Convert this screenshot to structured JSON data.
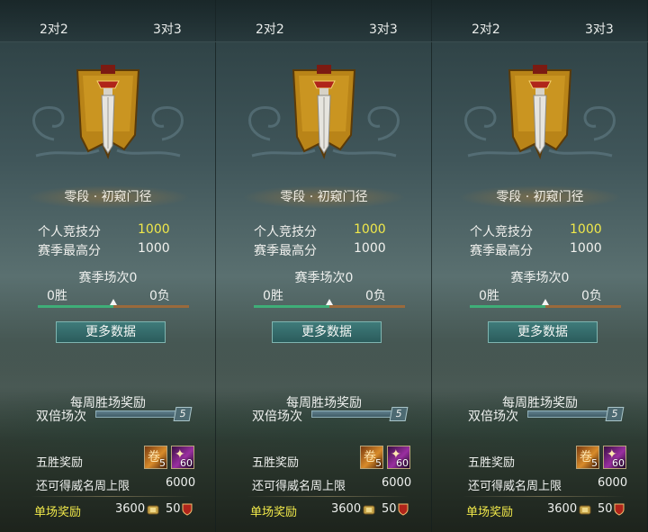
{
  "colors": {
    "score_yellow": "#f0e84a",
    "progress_win": "#3fae78",
    "progress_loss": "#9a6a3c",
    "button": "#2f6a68"
  },
  "panels": [
    {
      "tabs": [
        "2对2",
        "3对3"
      ],
      "rank_title": "零段 · 初窥门径",
      "personal_score_label": "个人竞技分",
      "personal_score": "1000",
      "season_high_label": "赛季最高分",
      "season_high": "1000",
      "season_matches": "赛季场次0",
      "wins": "0胜",
      "losses": "0负",
      "progress_fraction": 0.5,
      "more_data": "更多数据",
      "weekly_title": "每周胜场奖励",
      "double_label": "双倍场次",
      "double_count": "5",
      "five_win_label": "五胜奖励",
      "reward_items": [
        {
          "icon": "scroll-icon",
          "count": "5"
        },
        {
          "icon": "potion-icon",
          "count": "60"
        }
      ],
      "cap_label": "还可得威名周上限",
      "cap_value": "6000",
      "single_label": "单场奖励",
      "single_value1": "3600",
      "single_value2": "50"
    },
    {
      "tabs": [
        "2对2",
        "3对3"
      ],
      "rank_title": "零段 · 初窥门径",
      "personal_score_label": "个人竞技分",
      "personal_score": "1000",
      "season_high_label": "赛季最高分",
      "season_high": "1000",
      "season_matches": "赛季场次0",
      "wins": "0胜",
      "losses": "0负",
      "progress_fraction": 0.5,
      "more_data": "更多数据",
      "weekly_title": "每周胜场奖励",
      "double_label": "双倍场次",
      "double_count": "5",
      "five_win_label": "五胜奖励",
      "reward_items": [
        {
          "icon": "scroll-icon",
          "count": "5"
        },
        {
          "icon": "potion-icon",
          "count": "60"
        }
      ],
      "cap_label": "还可得威名周上限",
      "cap_value": "6000",
      "single_label": "单场奖励",
      "single_value1": "3600",
      "single_value2": "50"
    },
    {
      "tabs": [
        "2对2",
        "3对3"
      ],
      "rank_title": "零段 · 初窥门径",
      "personal_score_label": "个人竞技分",
      "personal_score": "1000",
      "season_high_label": "赛季最高分",
      "season_high": "1000",
      "season_matches": "赛季场次0",
      "wins": "0胜",
      "losses": "0负",
      "progress_fraction": 0.5,
      "more_data": "更多数据",
      "weekly_title": "每周胜场奖励",
      "double_label": "双倍场次",
      "double_count": "5",
      "five_win_label": "五胜奖励",
      "reward_items": [
        {
          "icon": "scroll-icon",
          "count": "5"
        },
        {
          "icon": "potion-icon",
          "count": "60"
        }
      ],
      "cap_label": "还可得威名周上限",
      "cap_value": "6000",
      "single_label": "单场奖励",
      "single_value1": "3600",
      "single_value2": "50"
    }
  ]
}
